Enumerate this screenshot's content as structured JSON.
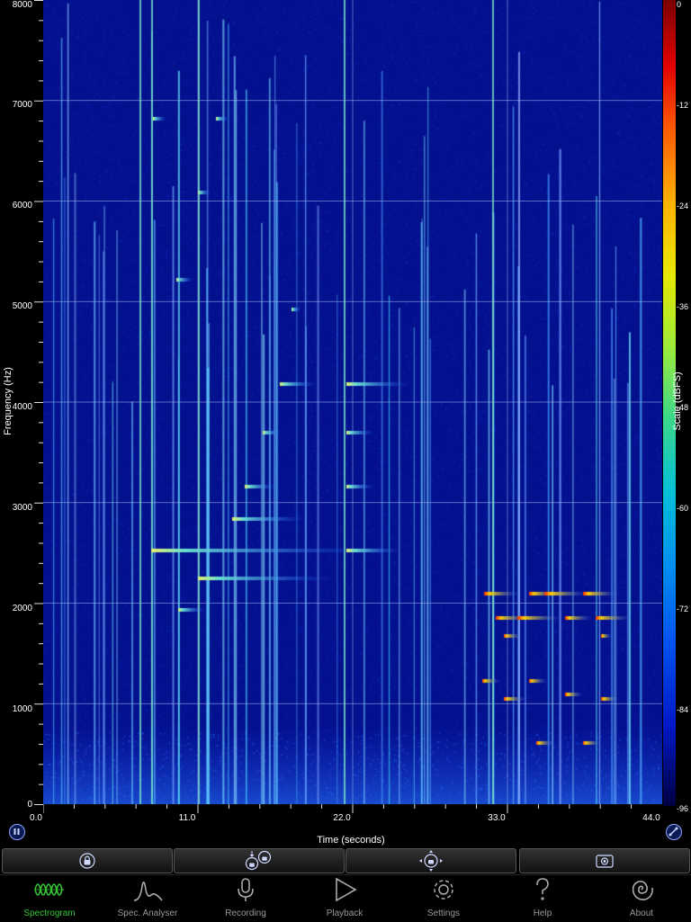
{
  "plot": {
    "y_axis_label": "Frequency (Hz)",
    "x_axis_label": "Time (seconds)",
    "colorbar_label": "Scale (dBFS)",
    "y_ticks": [
      "8000",
      "7000",
      "6000",
      "5000",
      "4000",
      "3000",
      "2000",
      "1000",
      "0"
    ],
    "x_ticks": [
      "0.0",
      "11.0",
      "22.0",
      "33.0",
      "44.0"
    ],
    "color_ticks": [
      "0",
      "-12",
      "-24",
      "-36",
      "-48",
      "-60",
      "-72",
      "-84",
      "-96"
    ]
  },
  "chart_data": {
    "type": "heatmap",
    "xlabel": "Time (seconds)",
    "ylabel": "Frequency (Hz)",
    "xlim": [
      0,
      44
    ],
    "ylim": [
      0,
      8000
    ],
    "colorbar_range_dbfs": [
      -96,
      0
    ],
    "grid": true,
    "colors": {
      "background": "#04118f",
      "grid": "#aabbee"
    }
  },
  "toolbar": {
    "buttons": [
      {
        "name": "lock-button",
        "icon": "lock-icon"
      },
      {
        "name": "zoom-lock-button",
        "icon": "vertical-zoom-lock-icon"
      },
      {
        "name": "pan-lock-button",
        "icon": "pan-lock-icon"
      },
      {
        "name": "snapshot-button",
        "icon": "camera-icon"
      }
    ]
  },
  "tabs": [
    {
      "label": "Spectrogram",
      "icon": "waveform-icon",
      "active": true
    },
    {
      "label": "Spec. Analyser",
      "icon": "peak-icon",
      "active": false
    },
    {
      "label": "Recording",
      "icon": "microphone-icon",
      "active": false
    },
    {
      "label": "Playback",
      "icon": "play-icon",
      "active": false
    },
    {
      "label": "Settings",
      "icon": "gear-icon",
      "active": false
    },
    {
      "label": "Help",
      "icon": "question-icon",
      "active": false
    },
    {
      "label": "About",
      "icon": "spiral-icon",
      "active": false
    }
  ]
}
